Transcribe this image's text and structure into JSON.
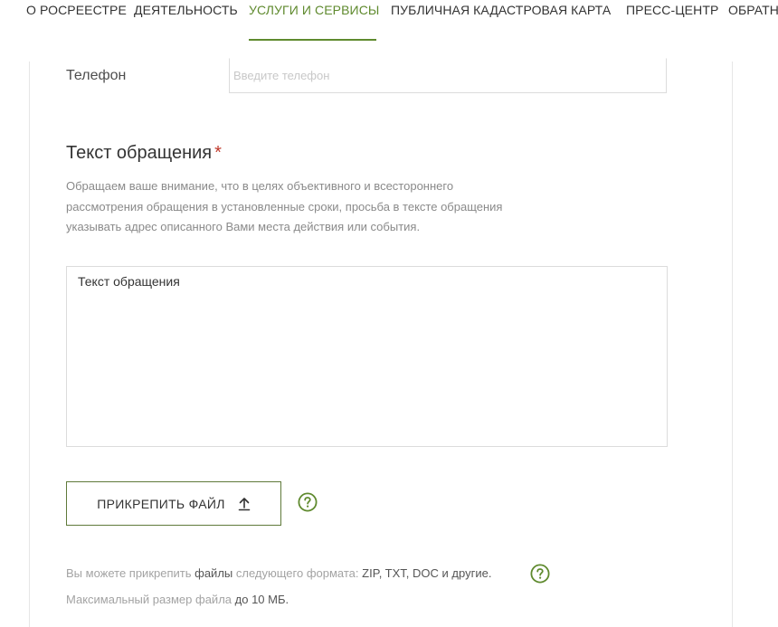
{
  "nav": {
    "items": [
      {
        "label": "О РОСРЕЕСТРЕ"
      },
      {
        "label": "ДЕЯТЕЛЬНОСТЬ"
      },
      {
        "label": "УСЛУГИ И СЕРВИСЫ"
      },
      {
        "label": "ПУБЛИЧНАЯ КАДАСТРОВАЯ КАРТА"
      },
      {
        "label": "ПРЕСС-ЦЕНТР"
      },
      {
        "label": "ОБРАТН"
      }
    ],
    "active_index": 2
  },
  "form": {
    "phone": {
      "label": "Телефон",
      "placeholder": "Введите телефон",
      "value": ""
    },
    "message": {
      "title": "Текст обращения",
      "required_mark": "*",
      "note_lines": [
        "Обращаем ваше внимание, что в целях объективного и всестороннего",
        "рассмотрения обращения в установленные сроки, просьба в тексте обращения",
        "указывать адрес описанного Вами места действия или события."
      ],
      "placeholder": "Текст обращения"
    },
    "attach": {
      "label": "ПРИКРЕПИТЬ ФАЙЛ",
      "icon": "upload-icon"
    },
    "help_icon": "question-circle-icon",
    "formats": {
      "prefix": "Вы можете прикрепить",
      "files": "файлы",
      "middle": "следующего формата:",
      "list": "ZIP, TXT, DOC",
      "conj": "и",
      "others": "другие."
    },
    "maxsize": {
      "prefix": "Максимальный размер файла",
      "value": "до 10 МБ."
    }
  },
  "colors": {
    "accent": "#5f8a2e",
    "required": "#c0392b",
    "border": "#dcdcdc",
    "muted_text": "#a3a3a3"
  }
}
